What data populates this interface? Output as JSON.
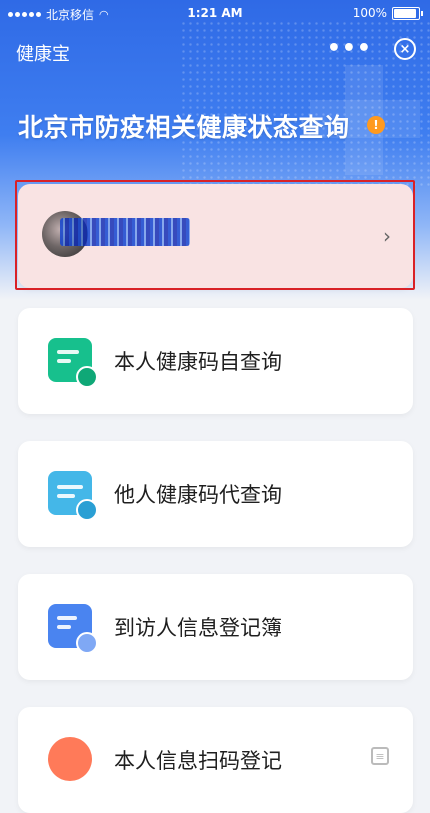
{
  "status_bar": {
    "carrier": "北京移信",
    "time": "1:21 AM",
    "battery": "100%"
  },
  "navbar": {
    "title": "健康宝",
    "more_label": "•••",
    "close_icon": "close-circle-icon"
  },
  "page": {
    "title": "北京市防疫相关健康状态查询",
    "info_badge": "!"
  },
  "user_card": {
    "chevron": "›"
  },
  "menu": [
    {
      "label": "本人健康码自查询",
      "icon": "document-eye-icon",
      "color": "#17c08d"
    },
    {
      "label": "他人健康码代查询",
      "icon": "calendar-search-icon",
      "color": "#44b7e8"
    },
    {
      "label": "到访人信息登记簿",
      "icon": "document-check-icon",
      "color": "#4a84f0"
    },
    {
      "label": "本人信息扫码登记",
      "icon": "smile-icon",
      "color": "#ff7a59"
    }
  ]
}
